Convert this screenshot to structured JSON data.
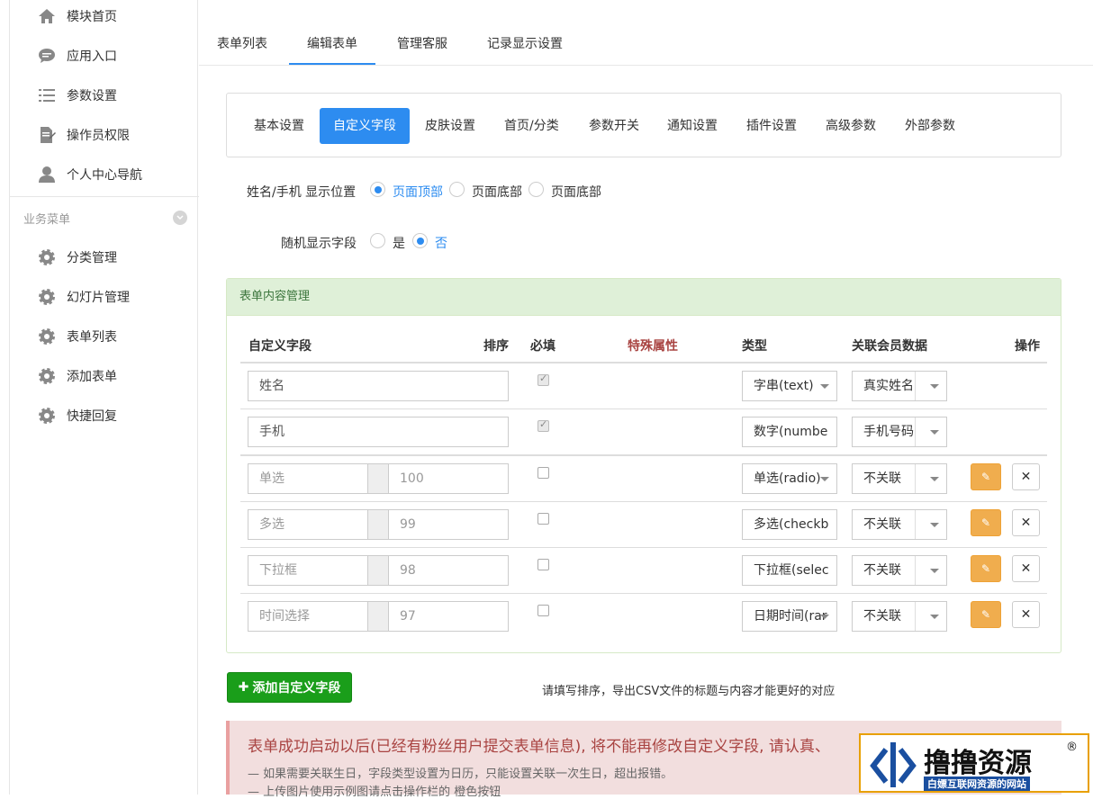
{
  "sidebar": {
    "items": [
      {
        "label": "模块首页",
        "icon": "home-icon"
      },
      {
        "label": "应用入口",
        "icon": "chat-icon"
      },
      {
        "label": "参数设置",
        "icon": "list-icon"
      },
      {
        "label": "操作员权限",
        "icon": "document-edit-icon"
      },
      {
        "label": "个人中心导航",
        "icon": "user-icon"
      }
    ],
    "group_title": "业务菜单",
    "group_items": [
      {
        "label": "分类管理",
        "icon": "gear-icon"
      },
      {
        "label": "幻灯片管理",
        "icon": "gear-icon"
      },
      {
        "label": "表单列表",
        "icon": "gear-icon"
      },
      {
        "label": "添加表单",
        "icon": "gear-icon"
      },
      {
        "label": "快捷回复",
        "icon": "gear-icon"
      }
    ]
  },
  "tabs": [
    "表单列表",
    "编辑表单",
    "管理客服",
    "记录显示设置"
  ],
  "active_tab": "编辑表单",
  "subtabs": [
    "基本设置",
    "自定义字段",
    "皮肤设置",
    "首页/分类",
    "参数开关",
    "通知设置",
    "插件设置",
    "高级参数",
    "外部参数"
  ],
  "active_subtab": "自定义字段",
  "position_setting": {
    "label": "姓名/手机 显示位置",
    "options": [
      "页面顶部",
      "页面底部",
      "页面底部"
    ],
    "selected": 0
  },
  "random_setting": {
    "label": "随机显示字段",
    "options": [
      "是",
      "否"
    ],
    "selected": 1
  },
  "panel": {
    "title": "表单内容管理",
    "headers": {
      "field": "自定义字段",
      "sort": "排序",
      "required": "必填",
      "special": "特殊属性",
      "type": "类型",
      "member": "关联会员数据",
      "ops": "操作"
    },
    "rows": [
      {
        "name": "姓名",
        "sort": "",
        "required": true,
        "type": "字串(text)",
        "member": "真实姓名",
        "editable": false
      },
      {
        "name": "手机",
        "sort": "",
        "required": true,
        "type": "数字(numbe",
        "member": "手机号码",
        "editable": false
      },
      {
        "name": "单选",
        "sort": "100",
        "required": false,
        "type": "单选(radio)",
        "member": "不关联",
        "editable": true
      },
      {
        "name": "多选",
        "sort": "99",
        "required": false,
        "type": "多选(checkb",
        "member": "不关联",
        "editable": true
      },
      {
        "name": "下拉框",
        "sort": "98",
        "required": false,
        "type": "下拉框(selec",
        "member": "不关联",
        "editable": true
      },
      {
        "name": "时间选择",
        "sort": "97",
        "required": false,
        "type": "日期时间(rar",
        "member": "不关联",
        "editable": true
      }
    ]
  },
  "add_button": "添加自定义字段",
  "hint": "请填写排序，导出CSV文件的标题与内容才能更好的对应",
  "alert": {
    "title": "表单成功启动以后(已经有粉丝用户提交表单信息), 将不能再修改自定义字段, 请认真、",
    "line1": "— 如果需要关联生日，字段类型设置为日历，只能设置关联一次生日，超出报错。",
    "line2": "— 上传图片使用示例图请点击操作栏的 橙色按钮"
  },
  "watermark": {
    "title": "撸撸资源",
    "subtitle": "白嫖互联网资源的网站",
    "reg": "®"
  },
  "colors": {
    "accent": "#2d8cf0",
    "success": "#1a9e1a",
    "warning": "#f0ad4e",
    "panel_head": "#dff0d8",
    "alert_bg": "#f2dede",
    "special_attr": "#a94442"
  }
}
